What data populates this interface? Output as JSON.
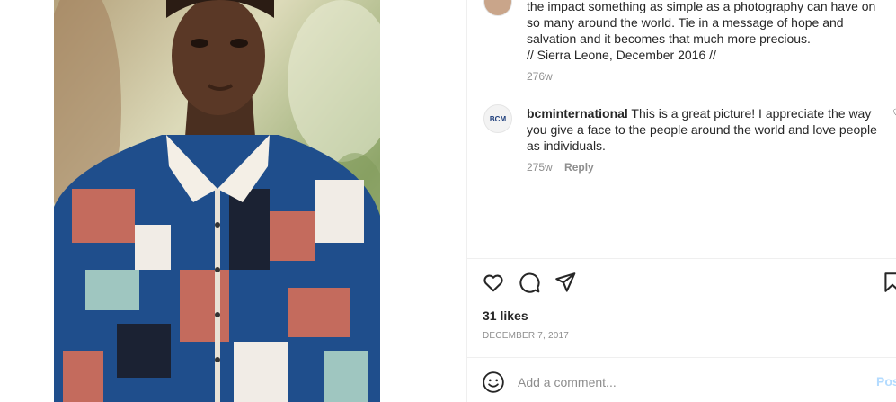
{
  "post_image": {
    "alt": ""
  },
  "comments": [
    {
      "text_lines": [
        "the impact something as simple as a photography can have on",
        "so many around the world. Tie in a message of hope and",
        "salvation and it becomes that much more precious.",
        "// Sierra Leone, December 2016 //"
      ],
      "age": "276w"
    },
    {
      "avatar_label": "BCM",
      "username": "bcminternational",
      "text": " This is a great picture! I appreciate the way you give a face to the people around the world and love people as individuals.",
      "age": "275w",
      "reply_label": "Reply"
    }
  ],
  "actions": {
    "like_icon": "heart-icon",
    "comment_icon": "comment-bubble-icon",
    "share_icon": "paper-plane-icon",
    "save_icon": "bookmark-icon"
  },
  "likes": "31 likes",
  "date": "DECEMBER 7, 2017",
  "add_comment": {
    "placeholder": "Add a comment...",
    "post_label": "Post",
    "emoji_icon": "emoji-icon"
  },
  "colors": {
    "link_disabled": "#b3dbff",
    "muted": "#8e8e8e",
    "text": "#262626"
  }
}
